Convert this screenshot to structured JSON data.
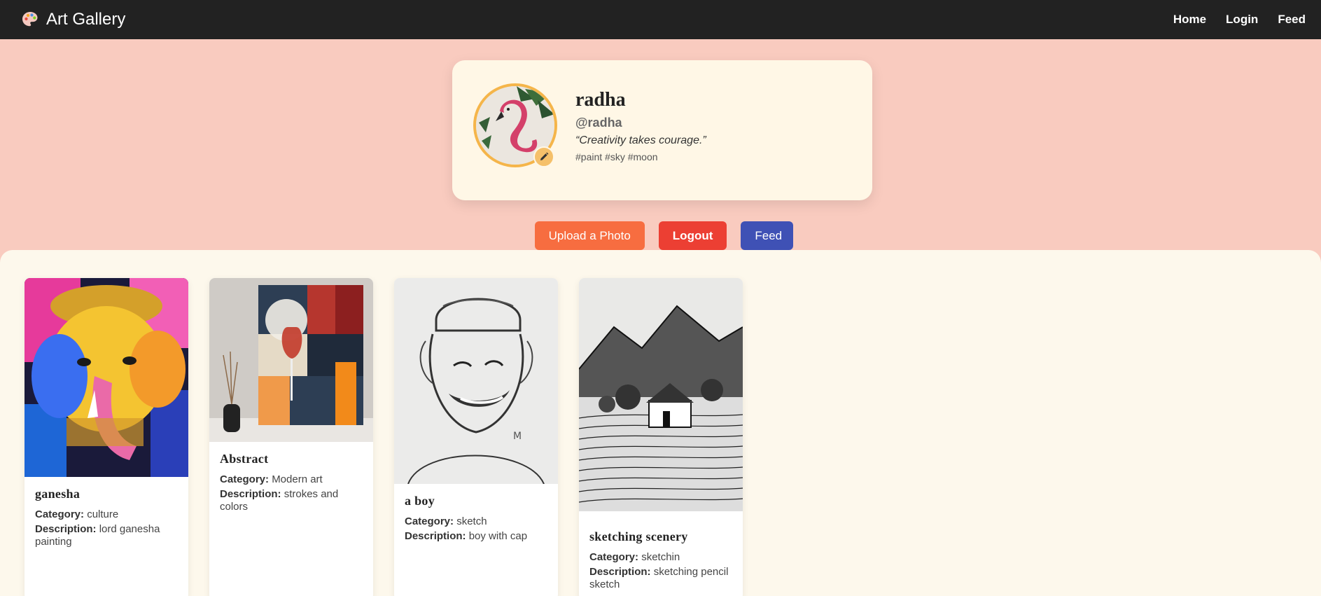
{
  "navbar": {
    "brand": "Art Gallery",
    "links": [
      "Home",
      "Login",
      "Feed"
    ]
  },
  "profile": {
    "name": "radha",
    "handle": "@radha",
    "quote": "“Creativity takes courage.”",
    "tags": "#paint #sky #moon"
  },
  "actions": {
    "upload": "Upload a Photo",
    "logout": "Logout",
    "feed": "Feed"
  },
  "labels": {
    "category": "Category:",
    "description": "Description:"
  },
  "posts": [
    {
      "title": "ganesha",
      "category": "culture",
      "description": "lord ganesha painting"
    },
    {
      "title": "Abstract",
      "category": "Modern art",
      "description": "strokes and colors"
    },
    {
      "title": "a boy",
      "category": "sketch",
      "description": "boy with cap"
    },
    {
      "title": "sketching scenery",
      "category": "sketchin",
      "description": "sketching pencil sketch"
    }
  ],
  "colors": {
    "navbar": "#222222",
    "page": "#f9cbbf",
    "card": "#fff7e6",
    "upload": "#f76d40",
    "logout": "#ec3f33",
    "feed": "#3f51b5"
  }
}
